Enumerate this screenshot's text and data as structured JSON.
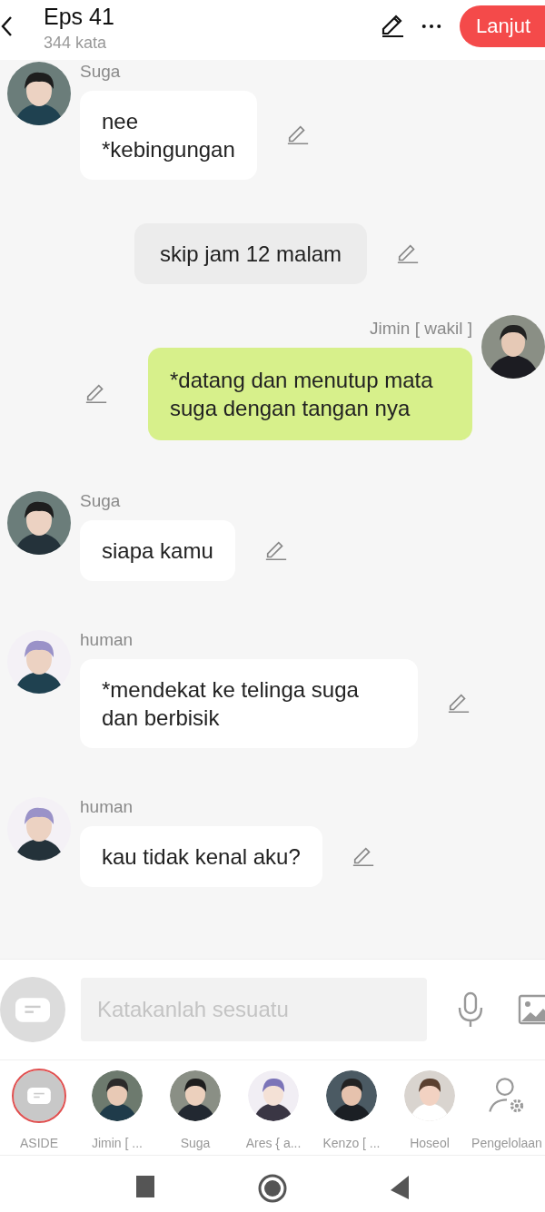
{
  "header": {
    "title": "Eps 41",
    "subtitle": "344 kata",
    "next_button": "Lanjut"
  },
  "messages": [
    {
      "kind": "left",
      "name": "Suga",
      "text": "nee\n*kebingungan"
    },
    {
      "kind": "aside",
      "text": "skip jam 12 malam"
    },
    {
      "kind": "right",
      "name": "Jimin [ wakil ]",
      "text": "*datang dan menutup mata suga dengan tangan nya"
    },
    {
      "kind": "left",
      "name": "Suga",
      "text": "siapa kamu"
    },
    {
      "kind": "left",
      "name": "human",
      "text": "*mendekat ke telinga suga dan berbisik"
    },
    {
      "kind": "left",
      "name": "human",
      "text": "kau tidak kenal aku?"
    }
  ],
  "composer": {
    "placeholder": "Katakanlah sesuatu"
  },
  "characters": [
    {
      "kind": "aside",
      "label": "ASIDE",
      "selected": true
    },
    {
      "kind": "avatar",
      "label": "Jimin [ ...",
      "selected": false
    },
    {
      "kind": "avatar",
      "label": "Suga",
      "selected": false
    },
    {
      "kind": "avatar",
      "label": "Ares { a...",
      "selected": false
    },
    {
      "kind": "avatar",
      "label": "Kenzo [ ...",
      "selected": false
    },
    {
      "kind": "avatar",
      "label": "Hoseol",
      "selected": false
    },
    {
      "kind": "manage",
      "label": "Pengelolaan",
      "selected": false
    }
  ]
}
